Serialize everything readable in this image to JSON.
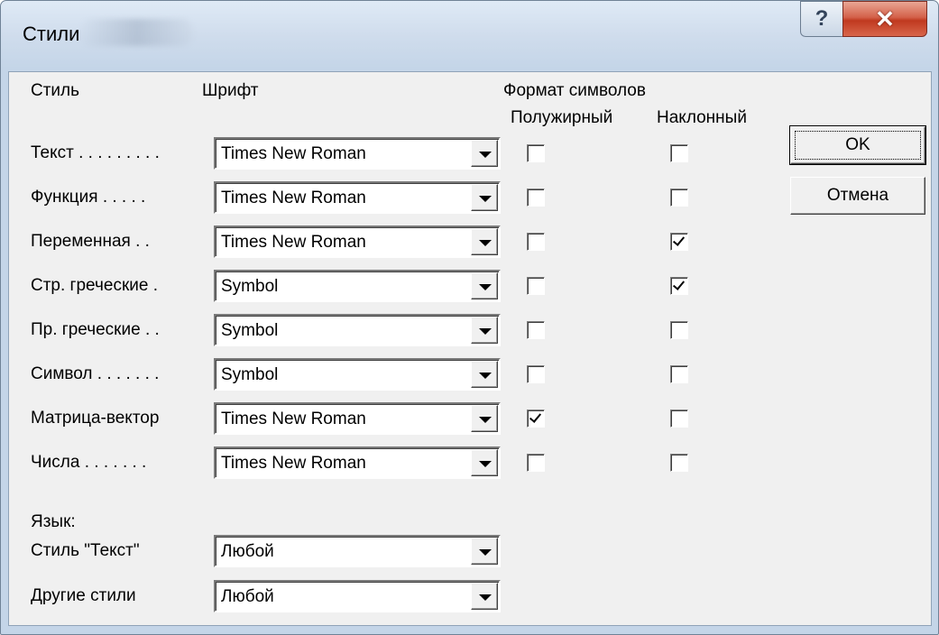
{
  "window": {
    "title": "Стили"
  },
  "headers": {
    "style": "Стиль",
    "font": "Шрифт",
    "char_format": "Формат символов",
    "bold": "Полужирный",
    "italic": "Наклонный"
  },
  "rows": [
    {
      "label": "Текст . . . . . . . . .",
      "font": "Times New Roman",
      "bold": false,
      "italic": false
    },
    {
      "label": "Функция  . . . . .",
      "font": "Times New Roman",
      "bold": false,
      "italic": false
    },
    {
      "label": "Переменная . .",
      "font": "Times New Roman",
      "bold": false,
      "italic": true
    },
    {
      "label": "Стр. греческие .",
      "font": "Symbol",
      "bold": false,
      "italic": true
    },
    {
      "label": "Пр. греческие . .",
      "font": "Symbol",
      "bold": false,
      "italic": false
    },
    {
      "label": "Символ . . . . . . .",
      "font": "Symbol",
      "bold": false,
      "italic": false
    },
    {
      "label": "Матрица-вектор",
      "font": "Times New Roman",
      "bold": true,
      "italic": false
    },
    {
      "label": "Числа . . . . . . .",
      "font": "Times New Roman",
      "bold": false,
      "italic": false
    }
  ],
  "language": {
    "title": "Язык:",
    "text_style_label": "Стиль \"Текст\"",
    "text_style_value": "Любой",
    "other_styles_label": "Другие стили",
    "other_styles_value": "Любой"
  },
  "buttons": {
    "ok": "OK",
    "cancel": "Отмена"
  },
  "icons": {
    "help": "help-icon",
    "close": "close-icon"
  },
  "colors": {
    "close_button": "#c0391f",
    "dialog_face": "#f0f0f0",
    "frame": "#c4d5e8"
  }
}
